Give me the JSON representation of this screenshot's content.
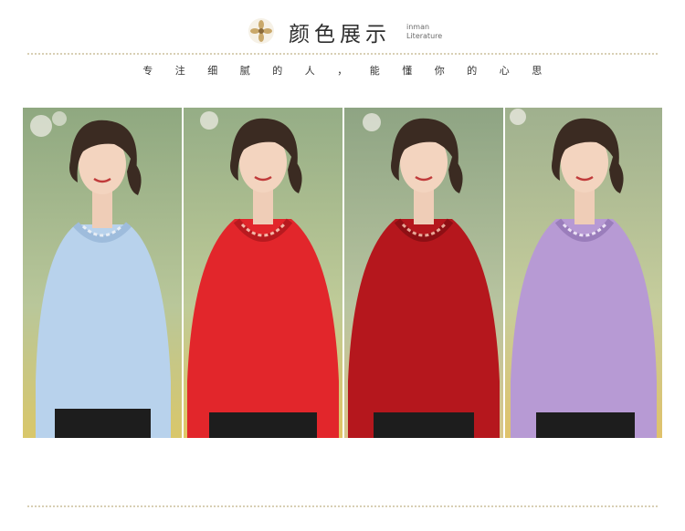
{
  "header": {
    "title": "颜色展示",
    "brand_line1": "inman",
    "brand_line2": "Literature",
    "icon": "flower-icon"
  },
  "subtitle": "专注细腻的人，能懂你的心思",
  "colors": {
    "accent_line": "#d8cfb4",
    "title": "#2f2f2f"
  },
  "panels": [
    {
      "name": "light-blue-sweater",
      "sweater": "#b8d2ec",
      "shade": "#9ebcdc",
      "bg_top": "#8fa880",
      "bg_bottom": "#d9c76a"
    },
    {
      "name": "red-sweater",
      "sweater": "#e2262b",
      "shade": "#b81a1f",
      "bg_top": "#95ad86",
      "bg_bottom": "#e1c664"
    },
    {
      "name": "wine-red-sweater",
      "sweater": "#b5171d",
      "shade": "#8d0f14",
      "bg_top": "#8ea483",
      "bg_bottom": "#d9c58a"
    },
    {
      "name": "lavender-sweater",
      "sweater": "#b79ad4",
      "shade": "#9a7dbb",
      "bg_top": "#9fb08e",
      "bg_bottom": "#e0c26a"
    }
  ]
}
